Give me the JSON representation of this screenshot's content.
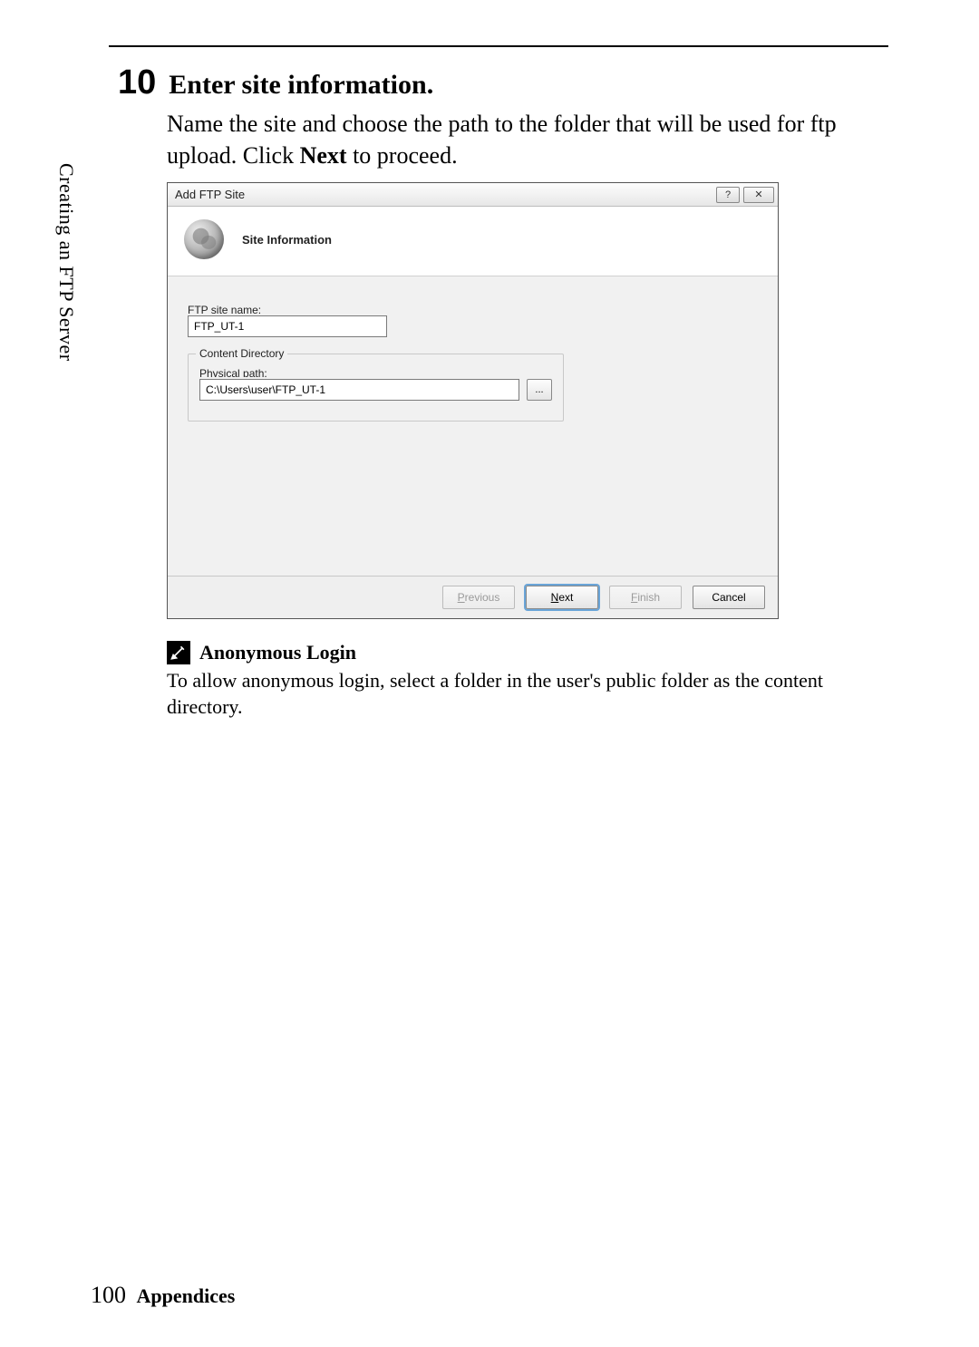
{
  "sidetab": "Creating an FTP Server",
  "step": {
    "number": "10",
    "title": "Enter site information.",
    "body_pre": "Name the site and choose the path to the folder that will be used for ftp upload. Click ",
    "body_bold": "Next",
    "body_post": " to proceed."
  },
  "dialog": {
    "window_title": "Add FTP Site",
    "header_title": "Site Information",
    "site_name_label": "FTP site name:",
    "site_name_value": "FTP_UT-1",
    "content_dir_legend": "Content Directory",
    "physical_path_label": "Physical path:",
    "physical_path_value": "C:\\Users\\user\\FTP_UT-1",
    "browse_label": "...",
    "buttons": {
      "previous": "Previous",
      "next": "Next",
      "finish": "Finish",
      "cancel": "Cancel"
    }
  },
  "note": {
    "title": "Anonymous Login",
    "body": "To allow anonymous login, select a folder in the user's public folder as the content directory."
  },
  "footer": {
    "page": "100",
    "section": "Appendices"
  }
}
